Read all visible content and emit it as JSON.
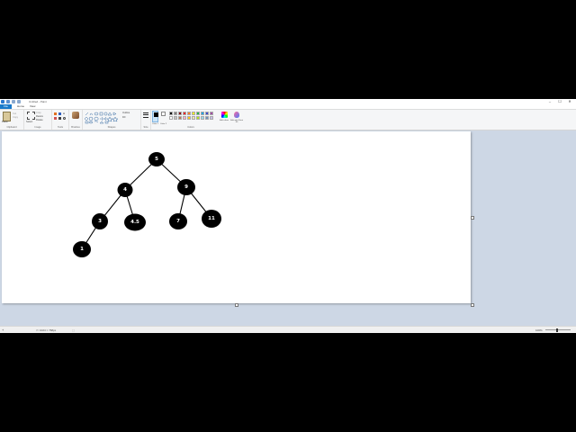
{
  "window": {
    "title": "Untitled - Paint",
    "controls": {
      "minimize": "–",
      "maximize": "☐",
      "close": "✕"
    }
  },
  "tabs": [
    {
      "label": "File",
      "active": true
    },
    {
      "label": "Home",
      "active": false
    },
    {
      "label": "View",
      "active": false
    }
  ],
  "ribbon": {
    "clipboard": {
      "paste": "Paste",
      "cut": "Cut",
      "copy": "Copy",
      "label": "Clipboard"
    },
    "image": {
      "select": "Select",
      "crop": "Crop",
      "resize": "Resize",
      "rotate": "Rotate",
      "label": "Image"
    },
    "tools": {
      "label": "Tools"
    },
    "brushes": {
      "label": "Brushes"
    },
    "shapes": {
      "outline": "Outline",
      "fill": "Fill",
      "label": "Shapes"
    },
    "size": {
      "label": "Size"
    },
    "colors": {
      "color1": "Color 1",
      "color2": "Color 2",
      "edit": "Edit colors",
      "label": "Colors"
    },
    "paint3d": {
      "label": "Edit with Paint 3D"
    },
    "palette": [
      "#000000",
      "#7f7f7f",
      "#880015",
      "#ed1c24",
      "#ff7f27",
      "#fff200",
      "#22b14c",
      "#00a2e8",
      "#3f48cc",
      "#a349a4",
      "#ffffff",
      "#c3c3c3",
      "#b97a57",
      "#ffaec9",
      "#ffc90e",
      "#efe4b0",
      "#b5e61d",
      "#99d9ea",
      "#7092be",
      "#c8bfe7"
    ]
  },
  "tree": {
    "nodes": [
      {
        "id": "n5",
        "label": "5"
      },
      {
        "id": "n4",
        "label": "4"
      },
      {
        "id": "n9",
        "label": "9"
      },
      {
        "id": "n3",
        "label": "3"
      },
      {
        "id": "n45",
        "label": "4.5"
      },
      {
        "id": "n7",
        "label": "7"
      },
      {
        "id": "n11",
        "label": "11"
      },
      {
        "id": "n1",
        "label": "1"
      }
    ],
    "edges": [
      [
        "n5",
        "n4"
      ],
      [
        "n5",
        "n9"
      ],
      [
        "n4",
        "n3"
      ],
      [
        "n4",
        "n45"
      ],
      [
        "n9",
        "n7"
      ],
      [
        "n9",
        "n11"
      ],
      [
        "n3",
        "n1"
      ]
    ]
  },
  "status": {
    "cursor": "",
    "selection": "",
    "canvas_size": "1024 × 768px",
    "zoom": "100%"
  },
  "colors": {
    "accent": "#1979ca",
    "workspace": "#cdd7e5"
  }
}
